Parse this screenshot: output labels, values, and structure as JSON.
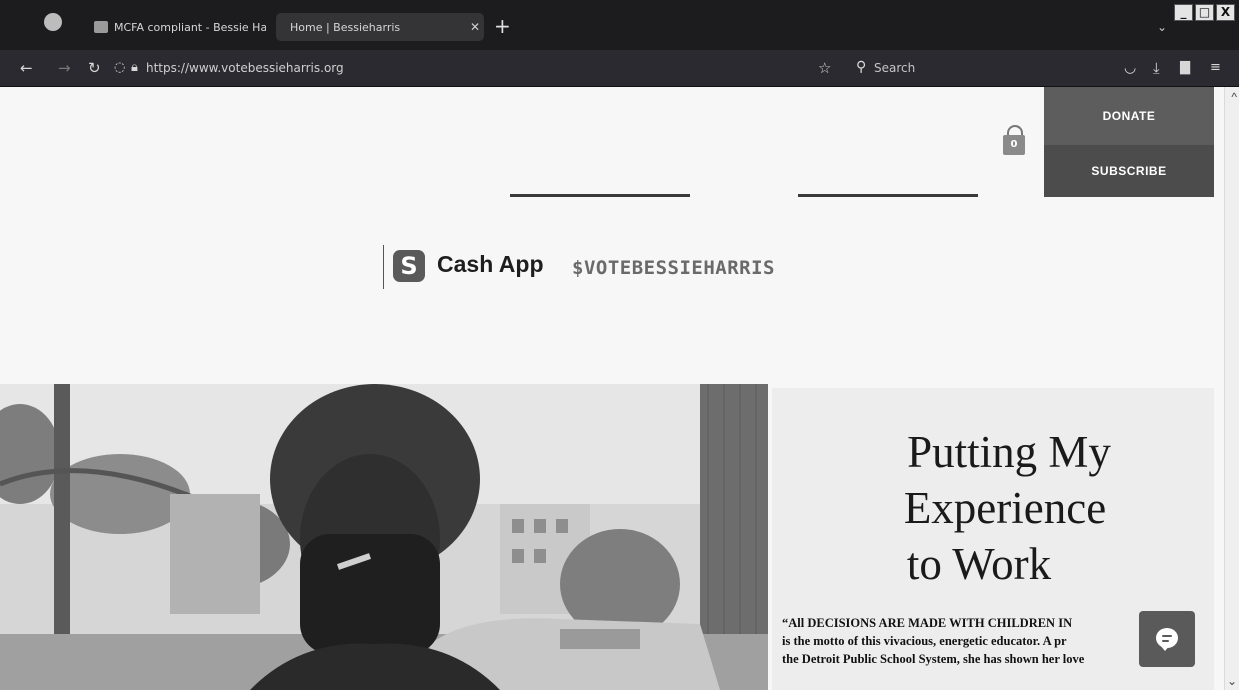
{
  "browser": {
    "tabs": [
      {
        "title": "MCFA compliant - Bessie Harris - ..."
      },
      {
        "title": "Home | Bessieharris"
      }
    ],
    "new_tab": "+",
    "url": "https://www.votebessieharris.org",
    "search_placeholder": "Search",
    "window_controls": [
      "_",
      "□",
      "X"
    ]
  },
  "header": {
    "cart_count": "0",
    "donate_label": "DONATE",
    "subscribe_label": "SUBSCRIBE"
  },
  "cashapp": {
    "logo_glyph": "S",
    "name": "Cash App",
    "cashtag": "$VOTEBESSIEHARRIS"
  },
  "hero": {
    "headline_lines": [
      "Putting My",
      "Experience",
      "to Work"
    ],
    "quote_lines": [
      "“All DECISIONS ARE MADE WITH CHILDREN IN",
      "is the motto of this vivacious, energetic educator.  A pr",
      "the Detroit Public School System, she has shown her love"
    ]
  },
  "icons": [
    "back-arrow-icon",
    "forward-arrow-icon",
    "reload-icon",
    "shield-icon",
    "lock-icon",
    "bookmark-star-icon",
    "search-icon",
    "pocket-icon",
    "download-icon",
    "reader-icon",
    "extensions-icon",
    "cart-icon",
    "chat-icon"
  ]
}
